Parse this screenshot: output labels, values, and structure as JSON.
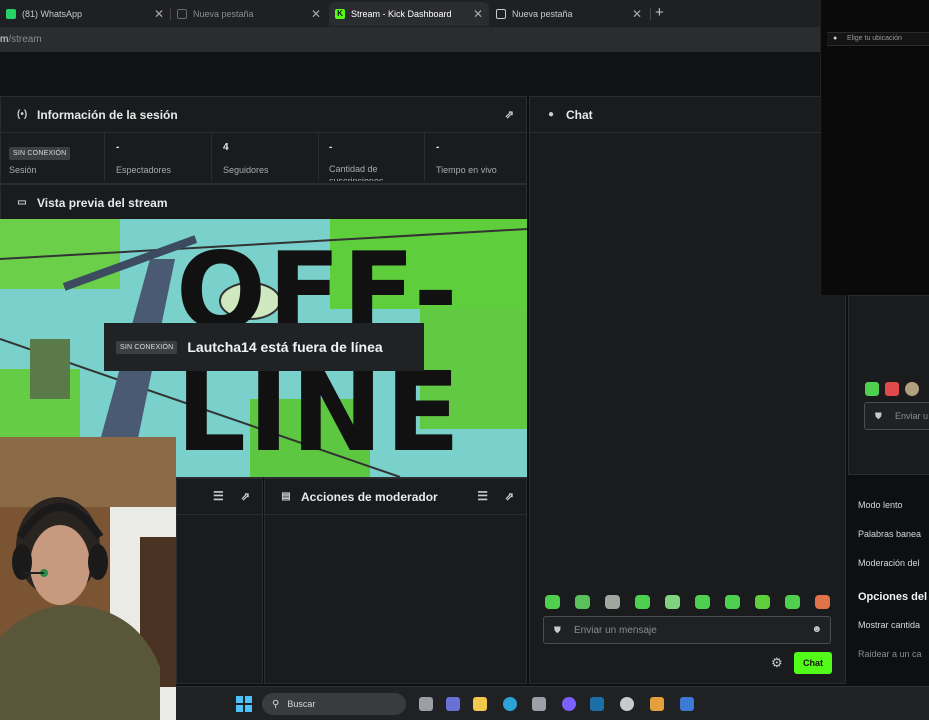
{
  "browser": {
    "tabs": [
      {
        "label": "(81) WhatsApp",
        "icon": "whatsapp-icon",
        "color": "#25d366"
      },
      {
        "label": "Nueva pestaña",
        "icon": "page-icon",
        "color": "#666a6e"
      },
      {
        "label": "Stream - Kick Dashboard",
        "icon": "kick-icon",
        "color": "#53fc18"
      },
      {
        "label": "Nueva pestaña",
        "icon": "page-icon",
        "color": "#c9cacc"
      }
    ],
    "new_tab": "+",
    "close": "✕",
    "url_prefix": "m",
    "url_rest": "/stream"
  },
  "session": {
    "title": "Información de la sesión",
    "stats": [
      {
        "value": "SIN CONEXIÓN",
        "label": "Sesión"
      },
      {
        "value": "-",
        "label": "Espectadores"
      },
      {
        "value": "4",
        "label": "Seguidores"
      },
      {
        "value": "-",
        "label": "Cantidad de suscripciones"
      },
      {
        "value": "-",
        "label": "Tiempo en vivo"
      }
    ]
  },
  "preview": {
    "title": "Vista previa del stream",
    "banner_line1": "OFF-",
    "banner_line2": "LINE",
    "badge": "SIN CONEXIÓN",
    "status_text": "Lautcha14 está fuera de línea"
  },
  "moderator": {
    "title": "Acciones de moderador"
  },
  "chat": {
    "title": "Chat",
    "input_placeholder": "Enviar un mensaje",
    "send_label": "Chat"
  },
  "right_panel": {
    "popup_text": "Elige tu ubicación",
    "input_placeholder": "Enviar u",
    "items": [
      "Modo lento",
      "Palabras banea",
      "Moderación del"
    ],
    "section_title": "Opciones del",
    "items2": [
      "Mostrar cantida",
      "Raidear a un ca"
    ]
  },
  "taskbar": {
    "search_label": "Buscar"
  },
  "colors": {
    "accent": "#53fc18",
    "panel": "#191b1c",
    "border": "#2a2d2f"
  }
}
